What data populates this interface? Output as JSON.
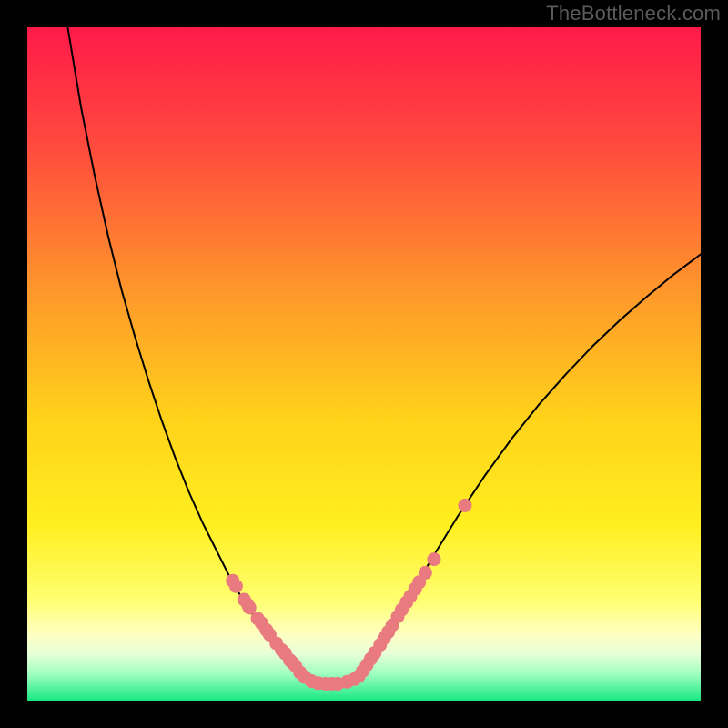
{
  "watermark": "TheBottleneck.com",
  "chart_data": {
    "type": "line",
    "title": "",
    "xlabel": "",
    "ylabel": "",
    "xlim": [
      0,
      100
    ],
    "ylim": [
      0,
      100
    ],
    "background_gradient": {
      "top": "#ff1a49",
      "mid": "#ffe500",
      "mid2": "#ffffa0",
      "bottom": "#18e884"
    },
    "series": [
      {
        "name": "left-curve",
        "type": "line",
        "x": [
          6,
          8,
          10,
          12,
          14,
          16,
          18,
          20,
          22,
          24,
          26,
          28,
          30,
          32,
          34,
          36,
          38,
          39,
          40,
          41
        ],
        "values": [
          100,
          88,
          78,
          69,
          61,
          54,
          47.5,
          41.5,
          36,
          31,
          26.5,
          22.5,
          18.5,
          15,
          12,
          9,
          6.5,
          5,
          3.8,
          3
        ]
      },
      {
        "name": "valley-flat",
        "type": "line",
        "x": [
          41,
          42,
          43,
          44,
          45,
          46,
          47,
          48,
          49
        ],
        "values": [
          3,
          2.5,
          2.2,
          2.1,
          2.1,
          2.1,
          2.2,
          2.5,
          3
        ]
      },
      {
        "name": "right-curve",
        "type": "line",
        "x": [
          49,
          50,
          52,
          54,
          56,
          58,
          60,
          64,
          68,
          72,
          76,
          80,
          84,
          88,
          92,
          96,
          100
        ],
        "values": [
          3,
          4,
          7,
          10.5,
          14,
          17.5,
          21,
          27.5,
          33.5,
          39,
          44,
          48.5,
          52.7,
          56.5,
          60,
          63.3,
          66.3
        ]
      }
    ],
    "markers": [
      {
        "name": "left-markers",
        "x": [
          30.5,
          31,
          32.2,
          32.8,
          33,
          34.2,
          34.8,
          35.5,
          36.0,
          37.0,
          37.8,
          38.3,
          39.0,
          39.4,
          39.8,
          40.5,
          41.2,
          42.2,
          43.2,
          44.3,
          45.2,
          46.1,
          47.5,
          48.6
        ],
        "values": [
          17.8,
          17.0,
          15.0,
          14.2,
          13.8,
          12.2,
          11.5,
          10.5,
          9.8,
          8.5,
          7.5,
          7.0,
          6.0,
          5.6,
          5.2,
          4.2,
          3.5,
          2.9,
          2.6,
          2.5,
          2.5,
          2.5,
          2.8,
          3.2
        ]
      },
      {
        "name": "right-markers",
        "x": [
          49.2,
          49.8,
          50.4,
          51.0,
          51.6,
          52.4,
          53.0,
          53.6,
          54.2,
          55.0,
          55.6,
          56.3,
          56.9,
          57.6,
          58.2,
          59.1,
          60.4,
          65.0
        ],
        "values": [
          3.6,
          4.4,
          5.3,
          6.2,
          7.1,
          8.3,
          9.3,
          10.2,
          11.2,
          12.5,
          13.5,
          14.6,
          15.5,
          16.6,
          17.6,
          19.0,
          21.0,
          29.0
        ]
      }
    ],
    "marker_color": "#e97a7f",
    "marker_radius": 7,
    "curve_color": "#000000",
    "curve_width": 2
  }
}
